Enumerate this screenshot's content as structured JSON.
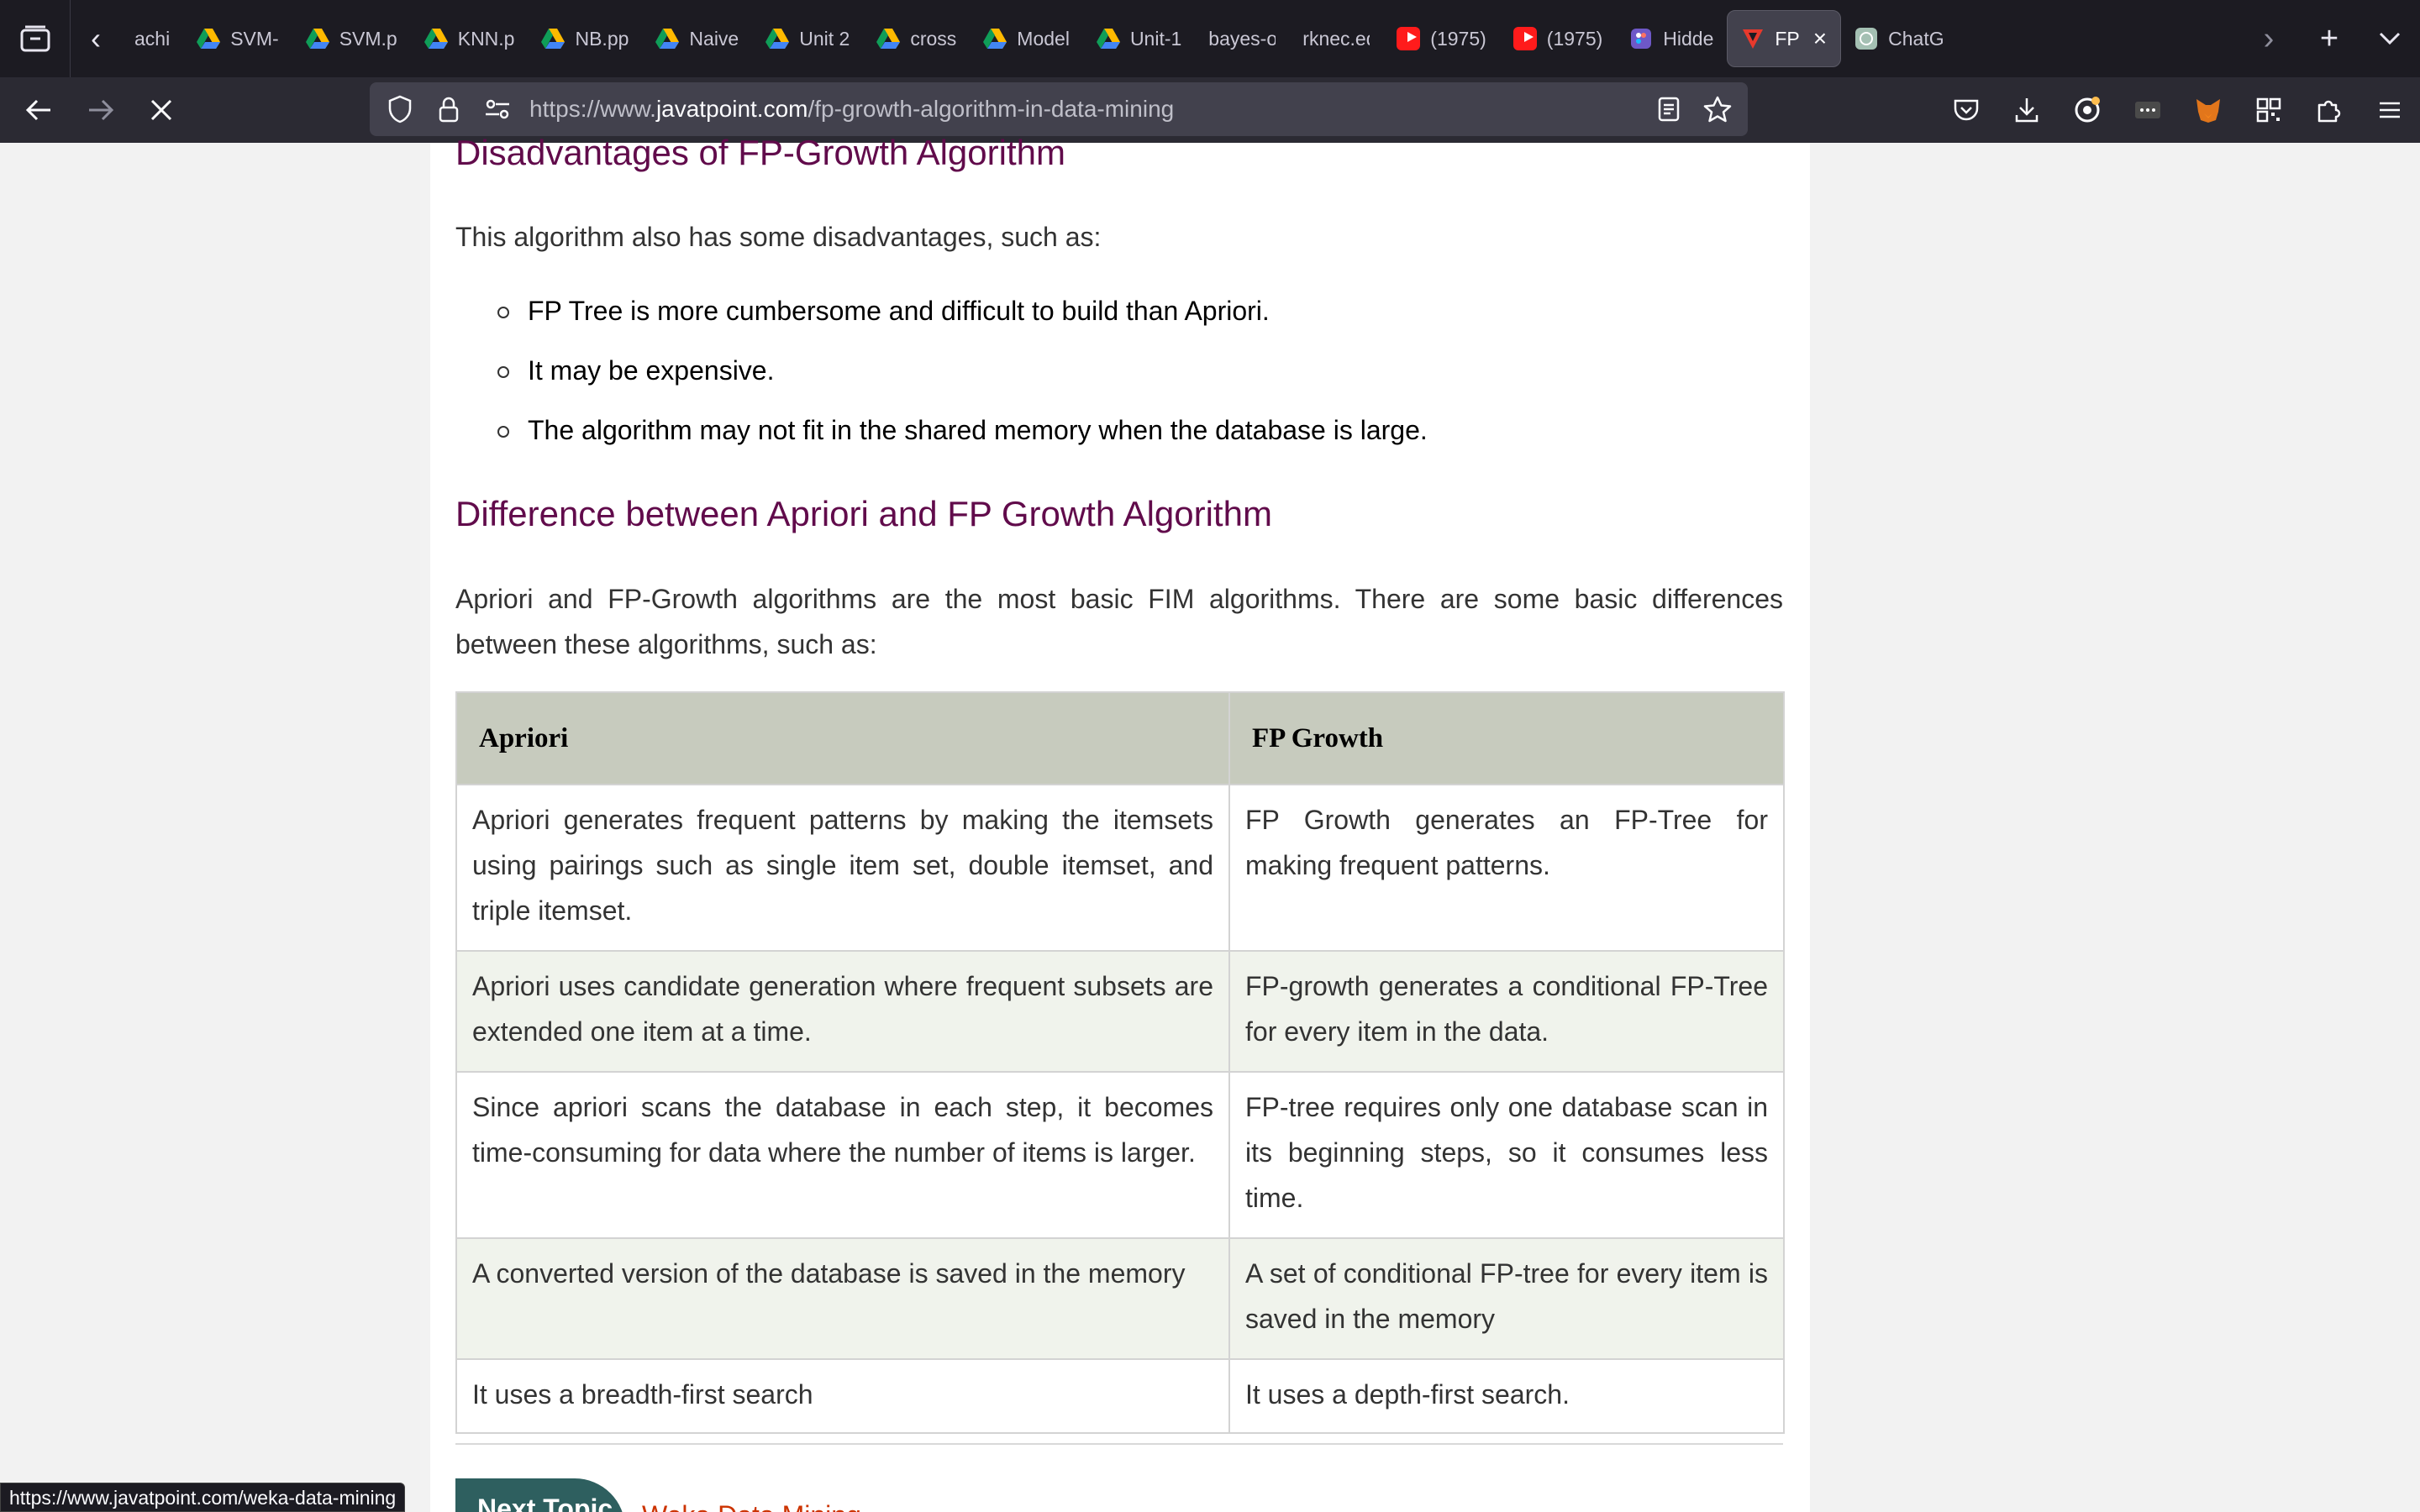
{
  "tabs": [
    {
      "label": "achi",
      "icon": "partial-tab"
    },
    {
      "label": "SVM-",
      "icon": "google-drive-icon"
    },
    {
      "label": "SVM.p",
      "icon": "google-drive-icon"
    },
    {
      "label": "KNN.p",
      "icon": "google-drive-icon"
    },
    {
      "label": "NB.pp",
      "icon": "google-drive-icon"
    },
    {
      "label": "Naive",
      "icon": "google-drive-icon"
    },
    {
      "label": "Unit 2",
      "icon": "google-drive-icon"
    },
    {
      "label": "cross",
      "icon": "google-drive-icon"
    },
    {
      "label": "Model",
      "icon": "google-drive-icon"
    },
    {
      "label": "Unit-1",
      "icon": "google-drive-icon"
    },
    {
      "label": "bayes-opt",
      "icon": "none"
    },
    {
      "label": "rknec.edu",
      "icon": "none"
    },
    {
      "label": "(1975)",
      "icon": "youtube-icon"
    },
    {
      "label": "(1975)",
      "icon": "youtube-icon"
    },
    {
      "label": "Hidde",
      "icon": "figma-icon"
    },
    {
      "label": "FP",
      "icon": "javatpoint-icon",
      "active": true
    },
    {
      "label": "ChatG",
      "icon": "chatgpt-icon"
    }
  ],
  "nav": {
    "url_prefix": "https://www.",
    "url_host": "javatpoint.com",
    "url_path": "/fp-growth-algorithm-in-data-mining"
  },
  "article": {
    "heading_disadv": "Disadvantages of FP-Growth Algorithm",
    "disadv_intro": "This algorithm also has some disadvantages, such as:",
    "disadv_items": [
      "FP Tree is more cumbersome and difficult to build than Apriori.",
      "It may be expensive.",
      "The algorithm may not fit in the shared memory when the database is large."
    ],
    "heading_diff": "Difference between Apriori and FP Growth Algorithm",
    "diff_intro": "Apriori and FP-Growth algorithms are the most basic FIM algorithms. There are some basic differences between these algorithms, such as:",
    "table": {
      "headers": [
        "Apriori",
        "FP Growth"
      ],
      "rows": [
        [
          "Apriori generates frequent patterns by making the itemsets using pairings such as single item set, double itemset, and triple itemset.",
          "FP Growth generates an FP-Tree for making frequent patterns."
        ],
        [
          "Apriori uses candidate generation where frequent subsets are extended one item at a time.",
          "FP-growth generates a conditional FP-Tree for every item in the data."
        ],
        [
          "Since apriori scans the database in each step, it becomes time-consuming for data where the number of items is larger.",
          "FP-tree requires only one database scan in its beginning steps, so it consumes less time."
        ],
        [
          "A converted version of the database is saved in the memory",
          "A set of conditional FP-tree for every item is saved in the memory"
        ],
        [
          "It uses a breadth-first search",
          "It uses a depth-first search."
        ]
      ]
    },
    "next_topic_label": "Next Topic",
    "next_topic_link": "Weka Data Mining"
  },
  "status_url": "https://www.javatpoint.com/weka-data-mining",
  "colors": {
    "heading": "#610b4b",
    "table_header_bg": "#c7cbbe",
    "table_alt_row_bg": "#f0f3ec",
    "toolbar_bg": "#2b2a33",
    "tabstrip_bg": "#1c1b22"
  }
}
